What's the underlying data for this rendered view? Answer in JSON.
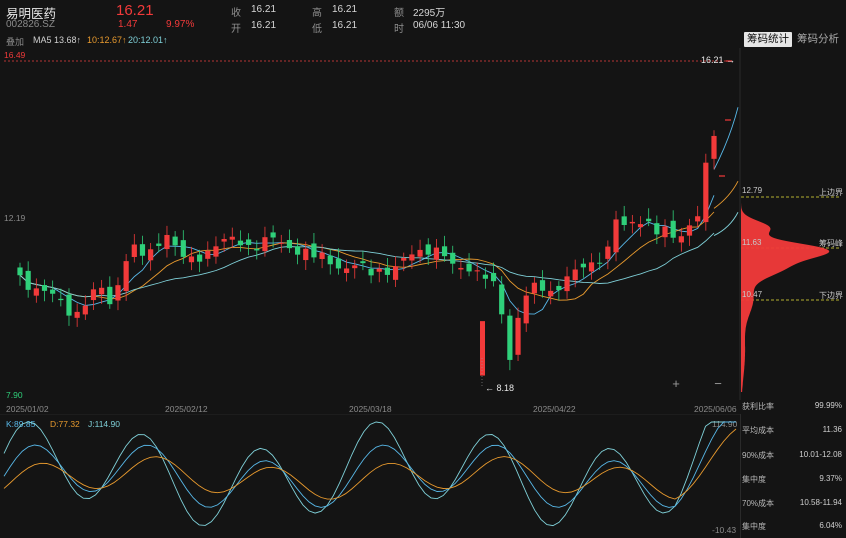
{
  "stock": {
    "name": "易明医药",
    "code": "002826.SZ",
    "price": "16.21",
    "change": "1.47",
    "change_pct": "9.97%"
  },
  "quote": {
    "close_label": "收",
    "close": "16.21",
    "open_label": "开",
    "open": "16.21",
    "high_label": "高",
    "high": "16.21",
    "low_label": "低",
    "low": "16.21",
    "amount_label": "额",
    "amount": "2295万",
    "time_label": "时",
    "time": "06/06 11:30"
  },
  "overlay": {
    "label": "叠加",
    "ma5": "MA5 13.68↑",
    "ma10": "10:12.67↑",
    "ma20": "20:12.01↑"
  },
  "tabs": [
    "筹码统计",
    "筹码分析"
  ],
  "price_axis": {
    "top": "16.49",
    "mid": "12.19",
    "bottom": "7.90",
    "last_price_tag": "16.21",
    "low_marker": "8.18"
  },
  "zoom": {
    "in": "+",
    "out": "−"
  },
  "dates": [
    "2025/01/02",
    "2025/02/12",
    "2025/03/18",
    "2025/04/22",
    "2025/06/06"
  ],
  "chip_distribution": {
    "upper_value": "12.79",
    "upper_label": "上边界",
    "peak_value": "11.63",
    "peak_label": "筹码峰",
    "lower_value": "10.47",
    "lower_label": "下边界"
  },
  "kdj": {
    "k": "K:89.85",
    "d": "D:77.32",
    "j": "J:114.90",
    "axis_top": "114.90",
    "axis_bottom": "-10.43"
  },
  "stats": [
    {
      "label": "获利比率",
      "value": "99.99%"
    },
    {
      "label": "平均成本",
      "value": "11.36"
    },
    {
      "label": "90%成本",
      "value": "10.01-12.08"
    },
    {
      "label": "集中度",
      "value": "9.37%"
    },
    {
      "label": "70%成本",
      "value": "10.58-11.94"
    },
    {
      "label": "集中度",
      "value": "6.04%"
    }
  ],
  "colors": {
    "up": "#f23a3a",
    "down": "#2fd07a",
    "ma5": "#58b8e8",
    "ma10": "#e89a2e",
    "ma20": "#7fd0d8",
    "chip_peak": "#e8e23a"
  }
}
